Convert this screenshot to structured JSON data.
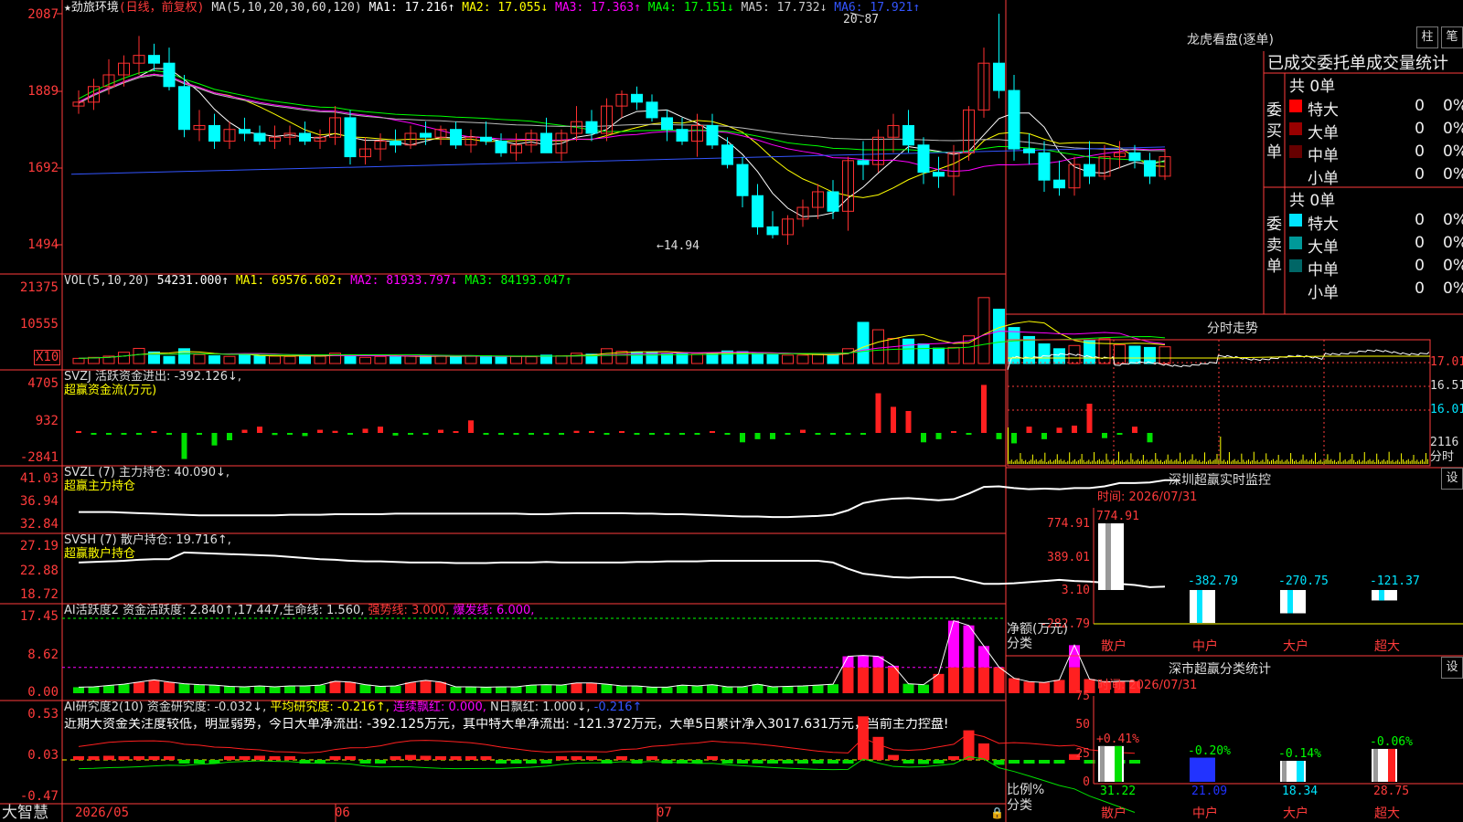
{
  "stock": {
    "name": "★劲旅环境",
    "mode": "(日线，前复权)"
  },
  "ma_main": {
    "label": "MA(5,10,20,30,60,120)",
    "items": [
      {
        "text": "MA1: 17.216↑",
        "color": "#ffffff"
      },
      {
        "text": "MA2: 17.055↓",
        "color": "#ffff00"
      },
      {
        "text": "MA3: 17.363↑",
        "color": "#ff00ff"
      },
      {
        "text": "MA4: 17.151↓",
        "color": "#00ff00"
      },
      {
        "text": "MA5: 17.732↓",
        "color": "#cccccc"
      },
      {
        "text": "MA6: 17.921↑",
        "color": "#3355ff"
      }
    ],
    "high_note": "20.87",
    "low_note": "←14.94",
    "yticks": [
      "2087",
      "1889",
      "1692",
      "1494"
    ]
  },
  "vol": {
    "label": "VOL(5,10,20)",
    "value": "54231.000↑",
    "items": [
      {
        "text": "MA1: 69576.602↑",
        "color": "#ffff00"
      },
      {
        "text": "MA2: 81933.797↓",
        "color": "#ff00ff"
      },
      {
        "text": "MA3: 84193.047↑",
        "color": "#00ff00"
      }
    ],
    "yticks": [
      "21375",
      "10555"
    ],
    "unit": "X10"
  },
  "svzj": {
    "label": "SVZJ  活跃资金进出: -392.126↓,",
    "sub": "超赢资金流(万元)",
    "yticks": [
      "4705",
      "932",
      "-2841"
    ]
  },
  "svzl": {
    "label": "SVZL (7) 主力持仓: 40.090↓,",
    "sub": "超赢主力持仓",
    "yticks": [
      "41.03",
      "36.94",
      "32.84"
    ]
  },
  "svsh": {
    "label": "SVSH (7) 散户持仓: 19.716↑,",
    "sub": "超赢散户持仓",
    "yticks": [
      "27.19",
      "22.88",
      "18.72"
    ]
  },
  "ai_active": {
    "label": "AI活跃度2 资金活跃度: 2.840↑,17.447,生命线: 1.560,",
    "strong": "强势线: 3.000,",
    "burst": "爆发线: 6.000,",
    "yticks": [
      "17.45",
      "8.62",
      "0.00"
    ]
  },
  "ai_research": {
    "label": "AI研究度2(10) 资金研究度: -0.032↓,",
    "avg": "平均研究度: -0.216↑,",
    "cont": "连续飘红: 0.000,",
    "nday": "N日飘红: 1.000↓,",
    "last": "-0.216↑",
    "comment": "近期大资金关注度较低，明显弱势，今日大单净流出: -392.125万元，其中特大单净流出: -121.372万元，大单5日累计净入3017.631万元，当前主力控盘!",
    "yticks": [
      "0.53",
      "0.03",
      "-0.47"
    ]
  },
  "footer": {
    "brand": "大智慧",
    "dates": [
      "2026/05",
      "06",
      "07"
    ]
  },
  "right": {
    "lhb_title": "龙虎看盘(逐单)",
    "btn_col": "柱",
    "btn_bi": "笔",
    "stat_title": "已成交委托单成交量统计",
    "buy": {
      "side_label": "委买单",
      "total": "共 0单",
      "rows": [
        {
          "name": "特大",
          "count": "0",
          "pct": "0%",
          "color": "#ff0000"
        },
        {
          "name": "大单",
          "count": "0",
          "pct": "0%",
          "color": "#990000"
        },
        {
          "name": "中单",
          "count": "0",
          "pct": "0%",
          "color": "#660000"
        },
        {
          "name": "小单",
          "count": "0",
          "pct": "0%",
          "color": "#000000"
        }
      ]
    },
    "sell": {
      "side_label": "委卖单",
      "total": "共 0单",
      "rows": [
        {
          "name": "特大",
          "count": "0",
          "pct": "0%",
          "color": "#00e5ff"
        },
        {
          "name": "大单",
          "count": "0",
          "pct": "0%",
          "color": "#009999"
        },
        {
          "name": "中单",
          "count": "0",
          "pct": "0%",
          "color": "#006666"
        },
        {
          "name": "小单",
          "count": "0",
          "pct": "0%",
          "color": "#000000"
        }
      ]
    },
    "fenshi": {
      "title": "分时走势",
      "yticks": [
        "17.01",
        "16.51",
        "16.01"
      ],
      "vol_tick": "2116",
      "vol_label": "分时"
    },
    "sz_monitor": {
      "title": "深圳超赢实时监控",
      "btn": "设",
      "time": "时间: 2026/07/31",
      "yticks": [
        "774.91",
        "389.01",
        "3.10",
        "-282.79"
      ],
      "ylabel1": "净额(万元)",
      "ylabel2": "分类",
      "bars": [
        {
          "cat": "散户",
          "value": 774.91,
          "label": "774.91"
        },
        {
          "cat": "中户",
          "value": -382.79,
          "label": "-382.79"
        },
        {
          "cat": "大户",
          "value": -270.75,
          "label": "-270.75"
        },
        {
          "cat": "超大",
          "value": -121.37,
          "label": "-121.37"
        }
      ]
    },
    "sz_class": {
      "title": "深市超赢分类统计",
      "btn": "设",
      "time": "时间: 2026/07/31",
      "yticks": [
        "75",
        "50",
        "25",
        "0"
      ],
      "ylabel1": "比例%",
      "ylabel2": "分类",
      "bars": [
        {
          "cat": "散户",
          "value": 31.22,
          "label": "31.22",
          "chg": "+0.41%",
          "chg_color": "#ff3b3b"
        },
        {
          "cat": "中户",
          "value": 21.09,
          "label": "21.09",
          "chg": "-0.20%",
          "chg_color": "#00ff00"
        },
        {
          "cat": "大户",
          "value": 18.34,
          "label": "18.34",
          "chg": "-0.14%",
          "chg_color": "#00ff00"
        },
        {
          "cat": "超大",
          "value": 28.75,
          "label": "28.75",
          "chg": "-0.06%",
          "chg_color": "#00ff00"
        }
      ]
    }
  },
  "chart_data": [
    {
      "type": "candlestick",
      "title": "劲旅环境 日线",
      "ylim": [
        14.94,
        20.87
      ],
      "yticks": [
        20.87,
        18.89,
        16.92,
        14.94
      ],
      "candles": [
        [
          18.5,
          18.9,
          18.3,
          18.6
        ],
        [
          18.6,
          19.2,
          18.4,
          19.0
        ],
        [
          19.0,
          19.7,
          18.8,
          19.3
        ],
        [
          19.3,
          19.8,
          19.0,
          19.6
        ],
        [
          19.6,
          20.3,
          19.3,
          19.8
        ],
        [
          19.8,
          20.1,
          19.4,
          19.6
        ],
        [
          19.6,
          20.0,
          18.9,
          19.0
        ],
        [
          19.0,
          19.3,
          17.7,
          17.9
        ],
        [
          17.9,
          18.4,
          17.6,
          18.0
        ],
        [
          18.0,
          18.3,
          17.4,
          17.6
        ],
        [
          17.6,
          18.1,
          17.4,
          17.9
        ],
        [
          17.9,
          18.2,
          17.6,
          17.8
        ],
        [
          17.8,
          18.0,
          17.5,
          17.6
        ],
        [
          17.6,
          18.0,
          17.4,
          17.7
        ],
        [
          17.7,
          18.0,
          17.5,
          17.8
        ],
        [
          17.8,
          18.1,
          17.5,
          17.6
        ],
        [
          17.6,
          17.9,
          17.4,
          17.7
        ],
        [
          17.7,
          18.5,
          17.5,
          18.2
        ],
        [
          18.2,
          18.4,
          17.0,
          17.2
        ],
        [
          17.2,
          17.7,
          17.0,
          17.4
        ],
        [
          17.4,
          17.8,
          17.1,
          17.6
        ],
        [
          17.6,
          17.9,
          17.3,
          17.5
        ],
        [
          17.5,
          18.0,
          17.4,
          17.8
        ],
        [
          17.8,
          18.1,
          17.5,
          17.7
        ],
        [
          17.7,
          18.0,
          17.5,
          17.9
        ],
        [
          17.9,
          18.1,
          17.4,
          17.5
        ],
        [
          17.5,
          17.9,
          17.3,
          17.7
        ],
        [
          17.7,
          18.1,
          17.5,
          17.6
        ],
        [
          17.6,
          17.8,
          17.2,
          17.3
        ],
        [
          17.3,
          17.8,
          17.1,
          17.5
        ],
        [
          17.5,
          17.9,
          17.3,
          17.8
        ],
        [
          17.8,
          18.2,
          17.5,
          17.3
        ],
        [
          17.3,
          17.9,
          17.1,
          17.8
        ],
        [
          17.8,
          18.5,
          17.6,
          18.1
        ],
        [
          18.1,
          18.4,
          17.6,
          17.8
        ],
        [
          17.8,
          18.7,
          17.6,
          18.5
        ],
        [
          18.5,
          18.9,
          18.2,
          18.8
        ],
        [
          18.8,
          19.0,
          18.4,
          18.6
        ],
        [
          18.6,
          18.8,
          18.1,
          18.2
        ],
        [
          18.2,
          18.4,
          17.6,
          17.9
        ],
        [
          17.9,
          18.2,
          17.5,
          17.6
        ],
        [
          17.6,
          18.3,
          17.2,
          18.0
        ],
        [
          18.0,
          18.3,
          17.4,
          17.5
        ],
        [
          17.5,
          17.7,
          16.9,
          17.0
        ],
        [
          17.0,
          17.2,
          15.9,
          16.2
        ],
        [
          16.2,
          16.5,
          15.2,
          15.4
        ],
        [
          15.4,
          15.8,
          15.1,
          15.2
        ],
        [
          15.2,
          15.7,
          14.94,
          15.6
        ],
        [
          15.6,
          16.1,
          15.4,
          15.9
        ],
        [
          15.9,
          16.5,
          15.6,
          16.3
        ],
        [
          16.3,
          16.6,
          15.6,
          15.8
        ],
        [
          15.8,
          17.2,
          15.3,
          17.1
        ],
        [
          17.1,
          17.6,
          16.6,
          17.0
        ],
        [
          17.0,
          17.9,
          16.8,
          17.7
        ],
        [
          17.7,
          18.3,
          17.3,
          18.0
        ],
        [
          18.0,
          18.4,
          17.3,
          17.5
        ],
        [
          17.5,
          17.7,
          16.5,
          16.8
        ],
        [
          16.8,
          17.2,
          16.4,
          16.7
        ],
        [
          16.7,
          17.5,
          16.2,
          17.3
        ],
        [
          17.3,
          18.5,
          17.1,
          18.4
        ],
        [
          18.4,
          20.0,
          18.2,
          19.6
        ],
        [
          19.6,
          20.87,
          18.7,
          18.9
        ],
        [
          18.9,
          19.3,
          17.1,
          17.4
        ],
        [
          17.4,
          17.8,
          17.0,
          17.3
        ],
        [
          17.3,
          17.6,
          16.3,
          16.6
        ],
        [
          16.6,
          17.1,
          16.2,
          16.4
        ],
        [
          16.4,
          17.2,
          16.2,
          17.0
        ],
        [
          17.0,
          17.6,
          16.5,
          16.7
        ],
        [
          16.7,
          17.5,
          16.6,
          17.2
        ],
        [
          17.2,
          17.6,
          16.9,
          17.3
        ],
        [
          17.3,
          17.5,
          16.9,
          17.1
        ],
        [
          17.1,
          17.3,
          16.5,
          16.7
        ],
        [
          16.7,
          17.4,
          16.6,
          17.2
        ]
      ]
    },
    {
      "type": "bar",
      "title": "VOL",
      "ylim": [
        0,
        25000
      ],
      "values": [
        1600,
        1900,
        2300,
        3500,
        4700,
        3600,
        2200,
        4600,
        2800,
        2400,
        2200,
        2600,
        2400,
        2300,
        2200,
        2400,
        2300,
        3200,
        2600,
        1900,
        2200,
        2100,
        2300,
        2400,
        2300,
        2100,
        2300,
        2400,
        2000,
        2200,
        2100,
        2600,
        2400,
        3200,
        2900,
        4600,
        3800,
        3600,
        3400,
        3100,
        3400,
        2900,
        3200,
        3900,
        3700,
        3100,
        2700,
        2600,
        2600,
        2800,
        2700,
        4600,
        12800,
        10500,
        7800,
        7600,
        6100,
        4800,
        5000,
        8600,
        20500,
        16900,
        11200,
        8400,
        6100,
        4600,
        5600,
        7100,
        7700,
        5800,
        5400,
        5000,
        5200
      ]
    },
    {
      "type": "bar",
      "title": "超赢资金流(万元)",
      "ylim": [
        -2841,
        4705
      ],
      "values": [
        60,
        -90,
        -120,
        -60,
        -50,
        80,
        -40,
        -2500,
        -100,
        -1200,
        -700,
        300,
        600,
        -200,
        -50,
        -300,
        300,
        200,
        -150,
        400,
        600,
        -250,
        -80,
        -100,
        300,
        120,
        1200,
        -60,
        -100,
        -50,
        -70,
        -80,
        -120,
        200,
        150,
        -100,
        100,
        -90,
        -40,
        -140,
        -120,
        -60,
        150,
        -80,
        -900,
        -600,
        -600,
        -40,
        300,
        -70,
        -80,
        -80,
        -60,
        3800,
        2500,
        2100,
        -900,
        -600,
        100,
        -50,
        4600,
        -600,
        -1000,
        600,
        -600,
        500,
        700,
        2800,
        -500,
        -100,
        600,
        -900
      ]
    },
    {
      "type": "line",
      "title": "超赢主力持仓",
      "ylim": [
        32.84,
        41.03
      ],
      "values": [
        35.2,
        35.2,
        35.2,
        35.1,
        35.0,
        34.9,
        34.8,
        34.7,
        34.6,
        34.6,
        34.6,
        34.6,
        34.6,
        34.6,
        34.7,
        34.7,
        34.7,
        34.8,
        34.8,
        34.8,
        34.8,
        34.9,
        34.9,
        34.9,
        34.9,
        34.9,
        34.9,
        34.9,
        34.9,
        34.9,
        34.8,
        34.8,
        34.9,
        35.0,
        35.0,
        35.0,
        35.0,
        34.9,
        34.9,
        34.8,
        34.8,
        34.7,
        34.6,
        34.5,
        34.4,
        34.4,
        34.3,
        34.3,
        34.4,
        34.5,
        34.7,
        35.5,
        36.8,
        37.3,
        37.6,
        37.7,
        37.5,
        37.3,
        37.5,
        38.5,
        39.7,
        39.8,
        39.5,
        39.3,
        39.4,
        39.3,
        39.5,
        39.5,
        39.8,
        40.4,
        40.4,
        40.5,
        40.9,
        40.9
      ]
    },
    {
      "type": "line",
      "title": "超赢散户持仓",
      "ylim": [
        18.72,
        27.19
      ],
      "values": [
        24.6,
        24.7,
        24.8,
        24.9,
        25.1,
        25.2,
        25.2,
        26.4,
        26.3,
        26.2,
        26.1,
        26.0,
        25.9,
        25.8,
        25.6,
        25.4,
        25.2,
        25.1,
        24.9,
        24.8,
        24.8,
        24.7,
        24.6,
        24.6,
        24.6,
        24.5,
        24.5,
        24.5,
        24.6,
        24.6,
        24.6,
        24.7,
        24.6,
        24.6,
        24.6,
        24.6,
        24.6,
        24.7,
        24.7,
        24.8,
        24.8,
        24.8,
        24.9,
        24.9,
        24.9,
        24.9,
        24.9,
        24.9,
        24.9,
        24.9,
        24.6,
        23.5,
        22.6,
        22.3,
        22.0,
        21.9,
        22.0,
        22.0,
        22.0,
        21.4,
        20.8,
        20.8,
        20.9,
        21.1,
        21.3,
        21.5,
        21.3,
        21.2,
        21.0,
        20.8,
        20.6,
        20.2,
        20.3
      ]
    },
    {
      "type": "bar",
      "title": "资金活跃度",
      "ylim": [
        0,
        17.45
      ],
      "values": [
        1.4,
        1.5,
        1.8,
        2.1,
        2.6,
        3.1,
        2.6,
        2.2,
        2.0,
        1.9,
        1.6,
        1.5,
        1.7,
        1.5,
        1.7,
        1.7,
        1.9,
        2.8,
        2.6,
        2.0,
        1.6,
        1.7,
        2.5,
        3.0,
        2.6,
        1.5,
        1.5,
        1.4,
        1.5,
        1.5,
        1.9,
        2.0,
        1.9,
        2.4,
        2.4,
        2.1,
        1.7,
        1.7,
        1.4,
        1.4,
        1.9,
        1.7,
        2.0,
        1.5,
        1.5,
        2.1,
        1.5,
        1.6,
        1.7,
        1.9,
        2.1,
        8.6,
        8.8,
        8.6,
        6.4,
        2.2,
        2.0,
        4.5,
        16.9,
        15.8,
        11.0,
        6.1,
        3.5,
        2.7,
        2.5,
        3.1,
        11.2,
        3.3,
        2.6,
        2.8,
        2.8
      ]
    },
    {
      "type": "bar",
      "title": "资金研究度",
      "ylim": [
        -0.47,
        0.53
      ],
      "values": [
        0.02,
        0.03,
        0.05,
        0.04,
        0.03,
        0.03,
        0.02,
        -0.04,
        -0.02,
        -0.03,
        0.02,
        0.03,
        0.05,
        0.02,
        0.02,
        -0.02,
        -0.02,
        0.03,
        0.03,
        -0.03,
        -0.03,
        0.03,
        0.06,
        0.05,
        0.03,
        0.02,
        0.02,
        0.01,
        -0.02,
        -0.02,
        -0.03,
        -0.02,
        0.02,
        0.04,
        0.02,
        -0.02,
        0.02,
        -0.02,
        0.01,
        -0.02,
        -0.02,
        -0.03,
        0.02,
        -0.02,
        -0.02,
        -0.02,
        -0.02,
        -0.02,
        -0.02,
        -0.03,
        -0.03,
        -0.02,
        0.53,
        0.28,
        0.06,
        -0.02,
        -0.05,
        -0.02,
        0.01,
        0.36,
        0.2,
        -0.06,
        -0.03,
        -0.03,
        -0.03,
        -0.02,
        0.07,
        -0.03,
        -0.03,
        -0.03,
        -0.03
      ]
    }
  ]
}
